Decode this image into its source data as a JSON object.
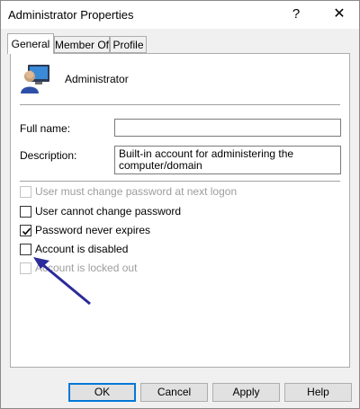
{
  "window": {
    "title": "Administrator Properties",
    "help_glyph": "?",
    "close_glyph": "✕"
  },
  "tabs": [
    {
      "label": "General",
      "active": true
    },
    {
      "label": "Member Of",
      "active": false
    },
    {
      "label": "Profile",
      "active": false
    }
  ],
  "general": {
    "user_icon": "user-monitor-icon",
    "username": "Administrator",
    "full_name_label": "Full name:",
    "full_name_value": "",
    "description_label": "Description:",
    "description_value": "Built-in account for administering the computer/domain"
  },
  "checkboxes": [
    {
      "label": "User must change password at next logon",
      "checked": false,
      "enabled": false
    },
    {
      "label": "User cannot change password",
      "checked": false,
      "enabled": true
    },
    {
      "label": "Password never expires",
      "checked": true,
      "enabled": true
    },
    {
      "label": "Account is disabled",
      "checked": false,
      "enabled": true
    },
    {
      "label": "Account is locked out",
      "checked": false,
      "enabled": false
    }
  ],
  "buttons": {
    "ok": "OK",
    "cancel": "Cancel",
    "apply": "Apply",
    "help": "Help"
  },
  "annotation": {
    "icon": "arrow-annotation-icon",
    "color": "#2a2a9a"
  }
}
